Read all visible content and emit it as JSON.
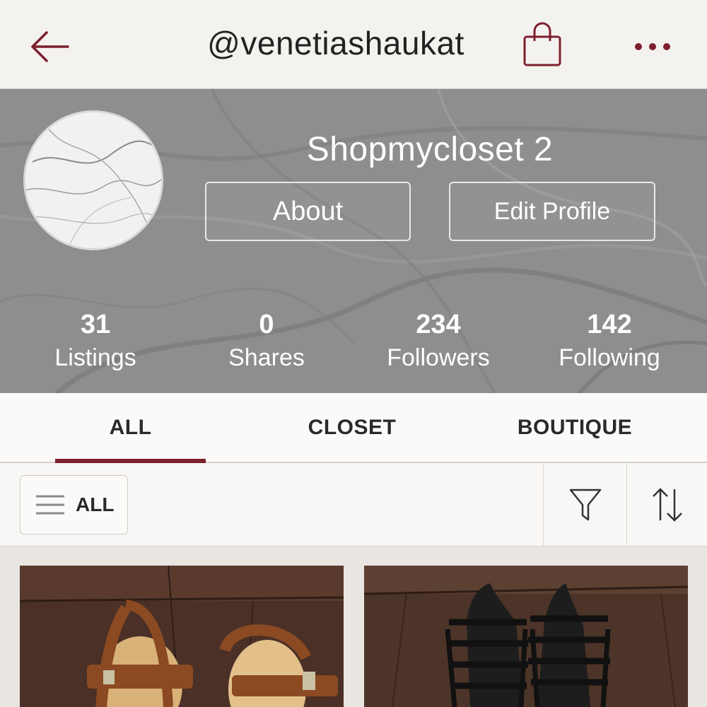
{
  "topbar": {
    "username": "@venetiashaukat",
    "back_icon": "arrow-left-icon",
    "bag_icon": "shopping-bag-icon",
    "more_icon": "more-dots-icon"
  },
  "profile": {
    "closet_name": "Shopmycloset 2",
    "about_label": "About",
    "edit_label": "Edit Profile",
    "stats": [
      {
        "value": "31",
        "label": "Listings"
      },
      {
        "value": "0",
        "label": "Shares"
      },
      {
        "value": "234",
        "label": "Followers"
      },
      {
        "value": "142",
        "label": "Following"
      }
    ]
  },
  "tabs": [
    {
      "label": "ALL",
      "active": true
    },
    {
      "label": "CLOSET",
      "active": false
    },
    {
      "label": "BOUTIQUE",
      "active": false
    }
  ],
  "filters": {
    "category_label": "ALL",
    "filter_icon": "funnel-icon",
    "sort_icon": "sort-arrows-icon"
  },
  "colors": {
    "accent": "#7d1f2e",
    "header_bg": "#f4f2ef"
  }
}
